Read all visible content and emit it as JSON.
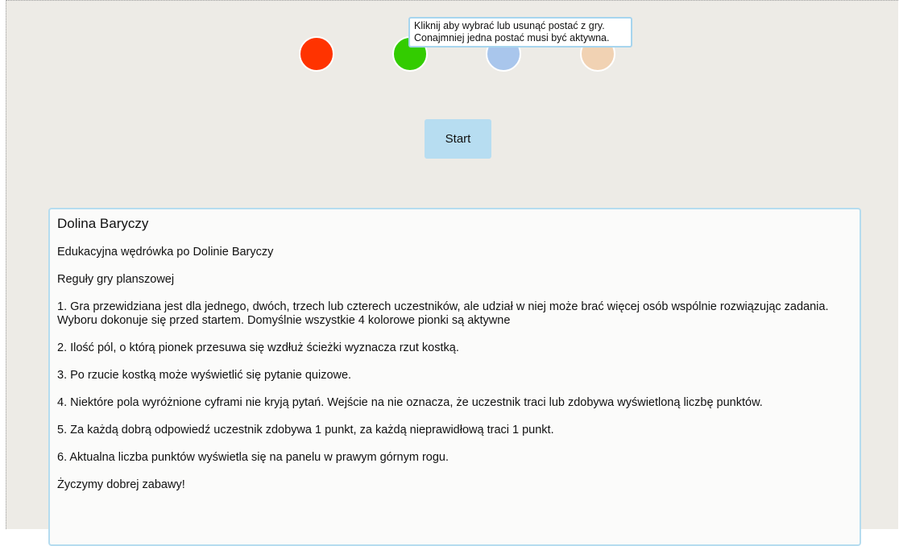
{
  "pawns": [
    {
      "id": "red",
      "color": "#ff3300",
      "active": true
    },
    {
      "id": "green",
      "color": "#33cc00",
      "active": true
    },
    {
      "id": "blue",
      "color": "#a9c6ec",
      "active": false
    },
    {
      "id": "orange",
      "color": "#f1d2b3",
      "active": false
    }
  ],
  "tooltip": {
    "line1": "Kliknij aby wybrać lub usunąć postać z gry.",
    "line2": "Conajmniej jedna postać musi być aktywna."
  },
  "start_label": "Start",
  "panel": {
    "title": "Dolina Baryczy",
    "subtitle": "Edukacyjna wędrówka po Dolinie Baryczy",
    "rules_heading": "Reguły gry planszowej",
    "rules": [
      "1. Gra przewidziana jest dla jednego, dwóch, trzech lub czterech uczestników, ale udział w niej może brać więcej osób wspólnie rozwiązując zadania. Wyboru dokonuje się przed startem. Domyślnie wszystkie 4 kolorowe pionki są aktywne",
      "2. Ilość pól, o którą pionek przesuwa się wzdłuż ścieżki wyznacza rzut kostką.",
      "3. Po rzucie kostką może wyświetlić się pytanie quizowe.",
      "4. Niektóre pola wyróżnione cyframi nie kryją pytań. Wejście na nie oznacza, że uczestnik traci lub zdobywa wyświetloną liczbę punktów.",
      "5. Za każdą dobrą odpowiedź uczestnik zdobywa 1 punkt, za każdą nieprawidłową traci 1 punkt.",
      "6. Aktualna liczba punktów wyświetla się na panelu w prawym górnym rogu."
    ],
    "closing": "Życzymy dobrej zabawy!"
  }
}
